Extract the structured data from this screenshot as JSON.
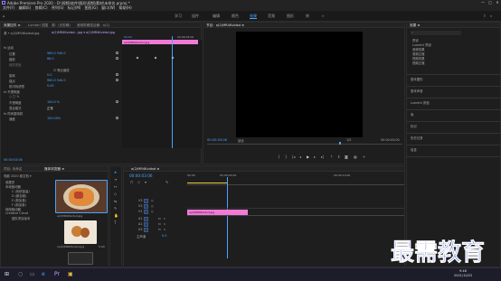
{
  "window": {
    "title": "Adobe Premiere Pro 2020 - D:\\视频\\软件\\图形\\视频\\素材\\未命名.prproj *",
    "controls": [
      "—",
      "□",
      "✕"
    ]
  },
  "menu": [
    "文件(F)",
    "编辑(E)",
    "剪辑(C)",
    "序列(S)",
    "标记(M)",
    "图形(G)",
    "窗口(W)",
    "帮助(H)"
  ],
  "workspaces": [
    "学习",
    "组件",
    "编辑",
    "颜色",
    "效果",
    "音频",
    "图形",
    "库"
  ],
  "active_workspace": "效果",
  "effect_controls": {
    "tabs": [
      "效果控件 ≡",
      "Lumetri 范围",
      "源：(无剪辑)",
      "音频剪辑混合器：a(2)"
    ],
    "source": "源 • a(2)MR4Kvidsd.jpg",
    "sequence": "a(2)MR4Kvidsd…jpg ▾ a(2)MR4Kvidsd.jpg",
    "timecode_left": "00:00",
    "timecode_right": "00:00:05:00",
    "clip_label": "a(2)MR4Kvidsd.jpg",
    "rows": [
      {
        "label": "fx  运动",
        "value": "",
        "indent": 1
      },
      {
        "label": "位置",
        "value": "960.0   540.0",
        "indent": 3
      },
      {
        "label": "缩放",
        "value": "66.0",
        "indent": 3
      },
      {
        "label": "缩放宽度",
        "value": "",
        "indent": 3,
        "dim": true
      },
      {
        "label": "",
        "value": "☑ 等比缩放",
        "indent": 6
      },
      {
        "label": "旋转",
        "value": "0.0",
        "indent": 3
      },
      {
        "label": "锚点",
        "value": "960.0   540.0",
        "indent": 3
      },
      {
        "label": "防闪烁滤镜",
        "value": "0.00",
        "indent": 3
      },
      {
        "label": "fx  不透明度",
        "value": "",
        "indent": 1
      },
      {
        "label": "○ □ ✎",
        "value": "",
        "indent": 3
      },
      {
        "label": "不透明度",
        "value": "100.0 %",
        "indent": 3
      },
      {
        "label": "混合模式",
        "value": "正常",
        "indent": 3
      },
      {
        "label": "fx  时间重映射",
        "value": "",
        "indent": 1
      },
      {
        "label": "速度",
        "value": "100.00%",
        "indent": 3
      }
    ],
    "bottom_timecode": "00:00:03:06"
  },
  "program": {
    "tabs": [
      "节目：a(2)MR4Kvidsd ≡"
    ],
    "timecode_left": "00:00:03:06",
    "fit": "适合",
    "quality": "1/2",
    "timecode_right": "00:00:05:00"
  },
  "effects_panel": {
    "tab": "效果 ≡",
    "items": [
      "预设",
      "Lumetri 预设",
      "音频效果",
      "音频过渡",
      "视频效果",
      "视频过渡"
    ],
    "sections": [
      "基本图形",
      "基本声音",
      "Lumetri 颜色",
      "库",
      "标记",
      "历史记录",
      "信息"
    ]
  },
  "project": {
    "tabs": [
      "项目: 未命名",
      "媒体浏览器 ≡"
    ],
    "path": "电脑 2020 版文档 ▾",
    "tree": [
      "收藏夹",
      "本地驱动器",
      "C (系统保留)",
      "D (新加卷)",
      "E (新加卷)",
      "F (新加卷)",
      "网络驱动器",
      "Creative Cloud",
      "团队项目版本"
    ],
    "thumbs": [
      {
        "label": "a(2)MR4Kvidsd.jpg",
        "duration": ""
      },
      {
        "label": "1a(2)MR4Kvidsd.jpg",
        "duration": "5:00"
      },
      {
        "label": "a(2)MR4Kvidsd.jpg",
        "duration": ""
      }
    ]
  },
  "timeline": {
    "tab": "a(2)MR4Kvidsd ≡",
    "timecode": "00:00:03:06",
    "ruler": [
      "00:00",
      "00:00:05:00",
      "00:00:10:00"
    ],
    "tracks": [
      "V3",
      "V2",
      "V1",
      "A1",
      "A2",
      "A3"
    ],
    "master": "主声道",
    "master_value": "0.0",
    "clip": "a(2)MR4Kvidsd.jpg"
  },
  "watermark": "最需教育",
  "taskbar": {
    "time": "9:48",
    "date": "2021/10/22"
  },
  "colors": {
    "accent": "#4aa3ff",
    "clip": "#f07ad6",
    "panel": "#1e1e1e"
  }
}
